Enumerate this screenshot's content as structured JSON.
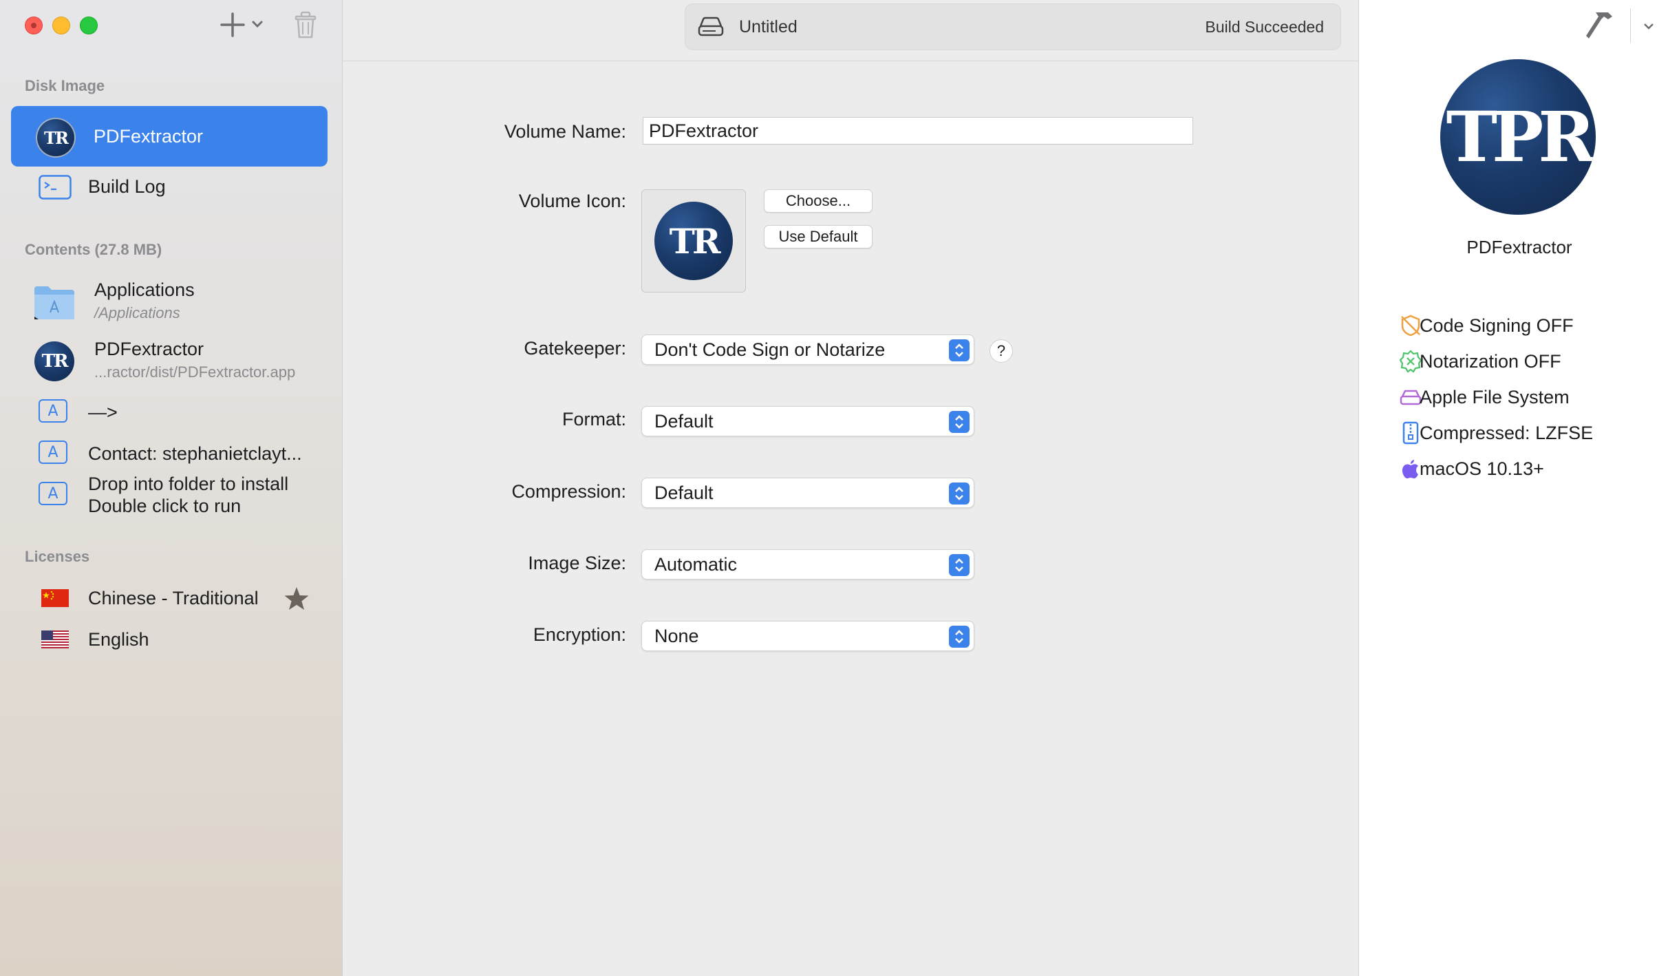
{
  "toolbar": {
    "document_title": "Untitled",
    "build_status": "Build Succeeded"
  },
  "sidebar": {
    "disk_image_header": "Disk Image",
    "disk_image_items": [
      {
        "label": "PDFextractor",
        "icon": "app-logo-icon",
        "selected": true
      },
      {
        "label": "Build Log",
        "icon": "terminal-icon"
      }
    ],
    "contents_header": "Contents (27.8 MB)",
    "contents_items": [
      {
        "label": "Applications",
        "subtitle": "/Applications",
        "icon": "applications-folder-icon"
      },
      {
        "label": "PDFextractor",
        "subtitle": "...ractor/dist/PDFextractor.app",
        "icon": "app-logo-icon"
      },
      {
        "label": "—>",
        "icon": "text-icon"
      },
      {
        "label": "Contact: stephanietclayt...",
        "icon": "text-icon"
      },
      {
        "label": "Drop into folder to install",
        "label2": "Double click to run",
        "icon": "text-icon"
      }
    ],
    "licenses_header": "Licenses",
    "licenses_items": [
      {
        "label": "Chinese - Traditional",
        "icon": "china-flag-icon",
        "default": true
      },
      {
        "label": "English",
        "icon": "us-flag-icon"
      }
    ]
  },
  "form": {
    "volume_name_label": "Volume Name:",
    "volume_name_value": "PDFextractor",
    "volume_icon_label": "Volume Icon:",
    "choose_button": "Choose...",
    "use_default_button": "Use Default",
    "gatekeeper_label": "Gatekeeper:",
    "gatekeeper_value": "Don't Code Sign or Notarize",
    "help_button": "?",
    "format_label": "Format:",
    "format_value": "Default",
    "compression_label": "Compression:",
    "compression_value": "Default",
    "image_size_label": "Image Size:",
    "image_size_value": "Automatic",
    "encryption_label": "Encryption:",
    "encryption_value": "None"
  },
  "inspector": {
    "app_name": "PDFextractor",
    "logo_text": "TPR",
    "items": [
      {
        "label": "Code Signing OFF",
        "icon": "code-signing-off-icon",
        "color": "#f0a040"
      },
      {
        "label": "Notarization OFF",
        "icon": "notarization-off-icon",
        "color": "#4cc46a"
      },
      {
        "label": "Apple File System",
        "icon": "drive-icon",
        "color": "#b36ad6"
      },
      {
        "label": "Compressed: LZFSE",
        "icon": "zip-icon",
        "color": "#3b82ea"
      },
      {
        "label": "macOS 10.13+",
        "icon": "apple-icon",
        "color": "#7a5cf0"
      }
    ]
  },
  "colors": {
    "accent": "#3b82ea",
    "logo_navy": "#1b3b6b"
  }
}
